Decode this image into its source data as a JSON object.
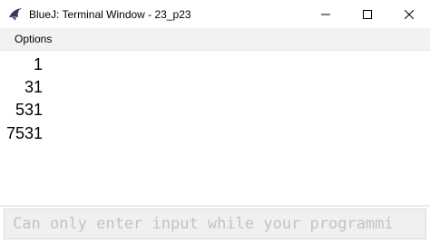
{
  "window": {
    "title": "BlueJ: Terminal Window - 23_p23"
  },
  "menu": {
    "options_label": "Options"
  },
  "output": {
    "lines": [
      "1",
      "31",
      "531",
      "7531"
    ]
  },
  "input": {
    "value": "",
    "placeholder": "Can only enter input while your programmi"
  }
}
